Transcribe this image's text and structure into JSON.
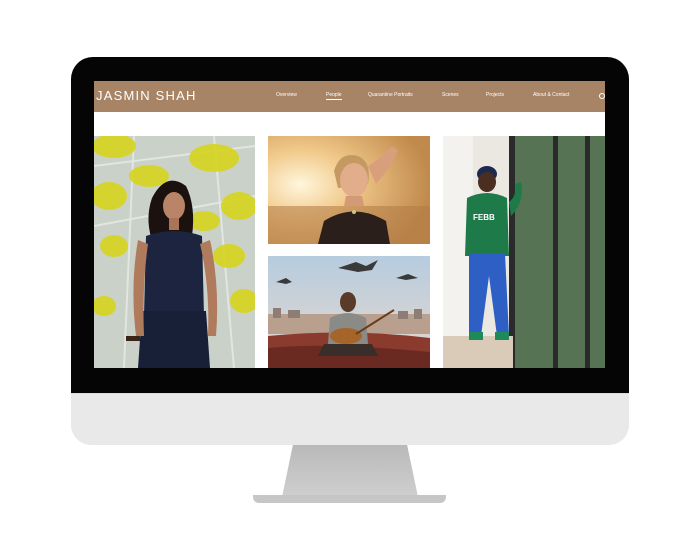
{
  "site": {
    "brand": "JASMIN SHAH",
    "nav": [
      {
        "label": "Overview",
        "active": false
      },
      {
        "label": "People",
        "active": true
      },
      {
        "label": "Quarantine Portraits",
        "active": false
      },
      {
        "label": "Scenes",
        "active": false
      },
      {
        "label": "Projects",
        "active": false
      },
      {
        "label": "About & Contact",
        "active": false
      }
    ]
  },
  "gallery": {
    "photos": [
      {
        "subject": "woman-yellow-leaves"
      },
      {
        "subject": "woman-sunset"
      },
      {
        "subject": "musician-rooftop-birds"
      },
      {
        "subject": "man-green-hoodie-window"
      }
    ]
  },
  "colors": {
    "navbar": "#a88466",
    "bezel": "#050505",
    "chin": "#e9e9e9"
  }
}
